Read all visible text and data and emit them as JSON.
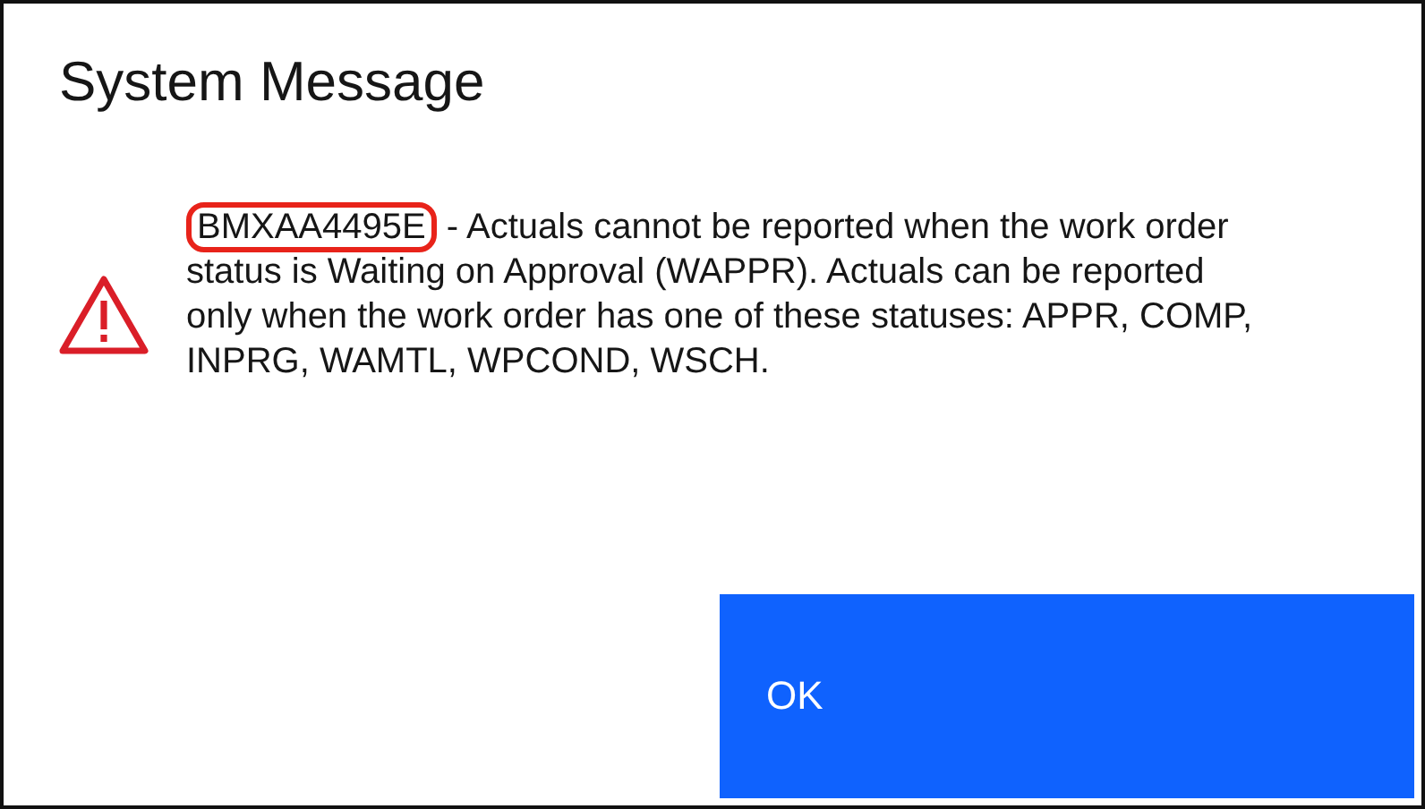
{
  "dialog": {
    "title": "System Message",
    "message": {
      "code": "BMXAA4495E",
      "code_circled": true,
      "text": " - Actuals cannot be reported when the work order status is Waiting on Approval (WAPPR). Actuals can be reported only when the work order has one of these statuses: APPR, COMP, INPRG, WAMTL, WPCOND, WSCH."
    },
    "buttons": [
      {
        "label": "OK",
        "kind": "primary"
      }
    ]
  }
}
